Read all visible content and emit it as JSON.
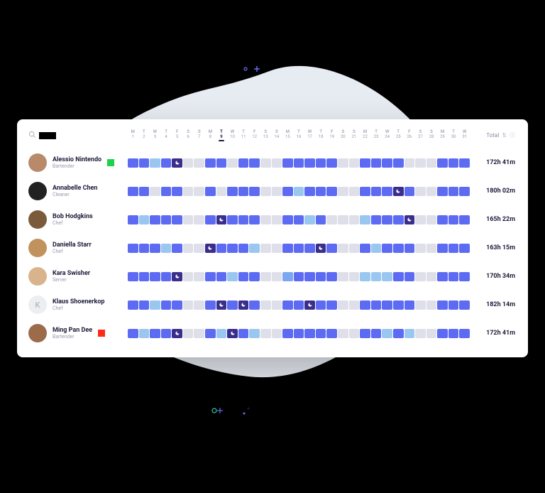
{
  "header": {
    "total_label": "Total"
  },
  "days": [
    {
      "dow": "M",
      "num": "1"
    },
    {
      "dow": "T",
      "num": "2"
    },
    {
      "dow": "W",
      "num": "3"
    },
    {
      "dow": "T",
      "num": "4"
    },
    {
      "dow": "F",
      "num": "5"
    },
    {
      "dow": "S",
      "num": "6"
    },
    {
      "dow": "S",
      "num": "7"
    },
    {
      "dow": "M",
      "num": "8"
    },
    {
      "dow": "T",
      "num": "9",
      "selected": true
    },
    {
      "dow": "W",
      "num": "10"
    },
    {
      "dow": "T",
      "num": "11"
    },
    {
      "dow": "F",
      "num": "12"
    },
    {
      "dow": "S",
      "num": "13"
    },
    {
      "dow": "S",
      "num": "14"
    },
    {
      "dow": "M",
      "num": "15"
    },
    {
      "dow": "T",
      "num": "16"
    },
    {
      "dow": "W",
      "num": "17"
    },
    {
      "dow": "T",
      "num": "18"
    },
    {
      "dow": "F",
      "num": "19"
    },
    {
      "dow": "S",
      "num": "20"
    },
    {
      "dow": "S",
      "num": "21"
    },
    {
      "dow": "M",
      "num": "22"
    },
    {
      "dow": "T",
      "num": "23"
    },
    {
      "dow": "W",
      "num": "24"
    },
    {
      "dow": "T",
      "num": "25"
    },
    {
      "dow": "F",
      "num": "26"
    },
    {
      "dow": "S",
      "num": "27"
    },
    {
      "dow": "S",
      "num": "28"
    },
    {
      "dow": "M",
      "num": "29"
    },
    {
      "dow": "T",
      "num": "30"
    },
    {
      "dow": "W",
      "num": "31"
    }
  ],
  "employees": [
    {
      "name": "Alessio Nintendo",
      "role": "Bartender",
      "avatar": "#b88a6a",
      "status": "#1bd24a",
      "total": "172h 41m",
      "cells": [
        "b",
        "b",
        "lb",
        "b",
        "d",
        "g",
        "g",
        "b",
        "b",
        "g",
        "b",
        "b",
        "g",
        "g",
        "b",
        "b",
        "b",
        "b",
        "b",
        "g",
        "g",
        "b",
        "b",
        "b",
        "b",
        "g",
        "g",
        "g",
        "b",
        "b",
        "b"
      ],
      "moons": [
        4
      ]
    },
    {
      "name": "Annabelle Chen",
      "role": "Cleaner",
      "avatar": "#222",
      "status": null,
      "total": "180h 02m",
      "cells": [
        "b",
        "b",
        "g",
        "b",
        "b",
        "g",
        "g",
        "b",
        "g",
        "b",
        "b",
        "b",
        "g",
        "g",
        "b",
        "lb",
        "b",
        "b",
        "b",
        "g",
        "g",
        "b",
        "b",
        "b",
        "d",
        "b",
        "g",
        "g",
        "b",
        "b",
        "b"
      ],
      "moons": [
        24
      ]
    },
    {
      "name": "Bob Hodgkins",
      "role": "Chef",
      "avatar": "#7a5a3a",
      "status": null,
      "total": "165h 22m",
      "cells": [
        "b",
        "lb",
        "b",
        "b",
        "b",
        "g",
        "g",
        "b",
        "d",
        "b",
        "b",
        "b",
        "g",
        "g",
        "b",
        "b",
        "lb",
        "b",
        "g",
        "g",
        "g",
        "lb",
        "b",
        "b",
        "b",
        "d",
        "g",
        "g",
        "b",
        "b",
        "b"
      ],
      "moons": [
        8,
        25
      ]
    },
    {
      "name": "Daniella Starr",
      "role": "Chef",
      "avatar": "#c2925e",
      "status": null,
      "total": "163h 15m",
      "cells": [
        "b",
        "b",
        "b",
        "lb",
        "b",
        "g",
        "g",
        "d",
        "b",
        "b",
        "b",
        "lb",
        "g",
        "g",
        "b",
        "b",
        "b",
        "d",
        "b",
        "g",
        "g",
        "b",
        "lb",
        "b",
        "b",
        "b",
        "g",
        "g",
        "b",
        "b",
        "b"
      ],
      "moons": [
        7,
        17
      ]
    },
    {
      "name": "Kara Swisher",
      "role": "Server",
      "avatar": "#d9b38c",
      "status": null,
      "total": "170h 34m",
      "cells": [
        "b",
        "b",
        "b",
        "b",
        "d",
        "g",
        "g",
        "b",
        "b",
        "lb",
        "b",
        "b",
        "g",
        "g",
        "mb",
        "b",
        "b",
        "b",
        "b",
        "g",
        "g",
        "lb",
        "lb",
        "lb",
        "b",
        "b",
        "g",
        "g",
        "b",
        "b",
        "b"
      ],
      "moons": [
        4
      ]
    },
    {
      "name": "Klaus Shoenerkop",
      "role": "Chef",
      "avatar": null,
      "letter": "K",
      "status": null,
      "total": "182h 14m",
      "cells": [
        "b",
        "b",
        "lb",
        "b",
        "b",
        "g",
        "g",
        "b",
        "d",
        "b",
        "d",
        "b",
        "g",
        "g",
        "b",
        "b",
        "d",
        "b",
        "b",
        "g",
        "g",
        "b",
        "b",
        "b",
        "b",
        "b",
        "g",
        "g",
        "b",
        "b",
        "b"
      ],
      "moons": [
        8,
        10,
        16
      ]
    },
    {
      "name": "Ming Pan Dee",
      "role": "Bartender",
      "avatar": "#9c6b4a",
      "status": "#ff2a1a",
      "total": "172h 41m",
      "cells": [
        "b",
        "lb",
        "b",
        "b",
        "d",
        "g",
        "g",
        "b",
        "lb",
        "d",
        "b",
        "lb",
        "g",
        "g",
        "b",
        "b",
        "b",
        "b",
        "b",
        "g",
        "g",
        "b",
        "b",
        "lb",
        "b",
        "lb",
        "g",
        "g",
        "b",
        "b",
        "b"
      ],
      "moons": [
        4,
        9
      ]
    }
  ]
}
